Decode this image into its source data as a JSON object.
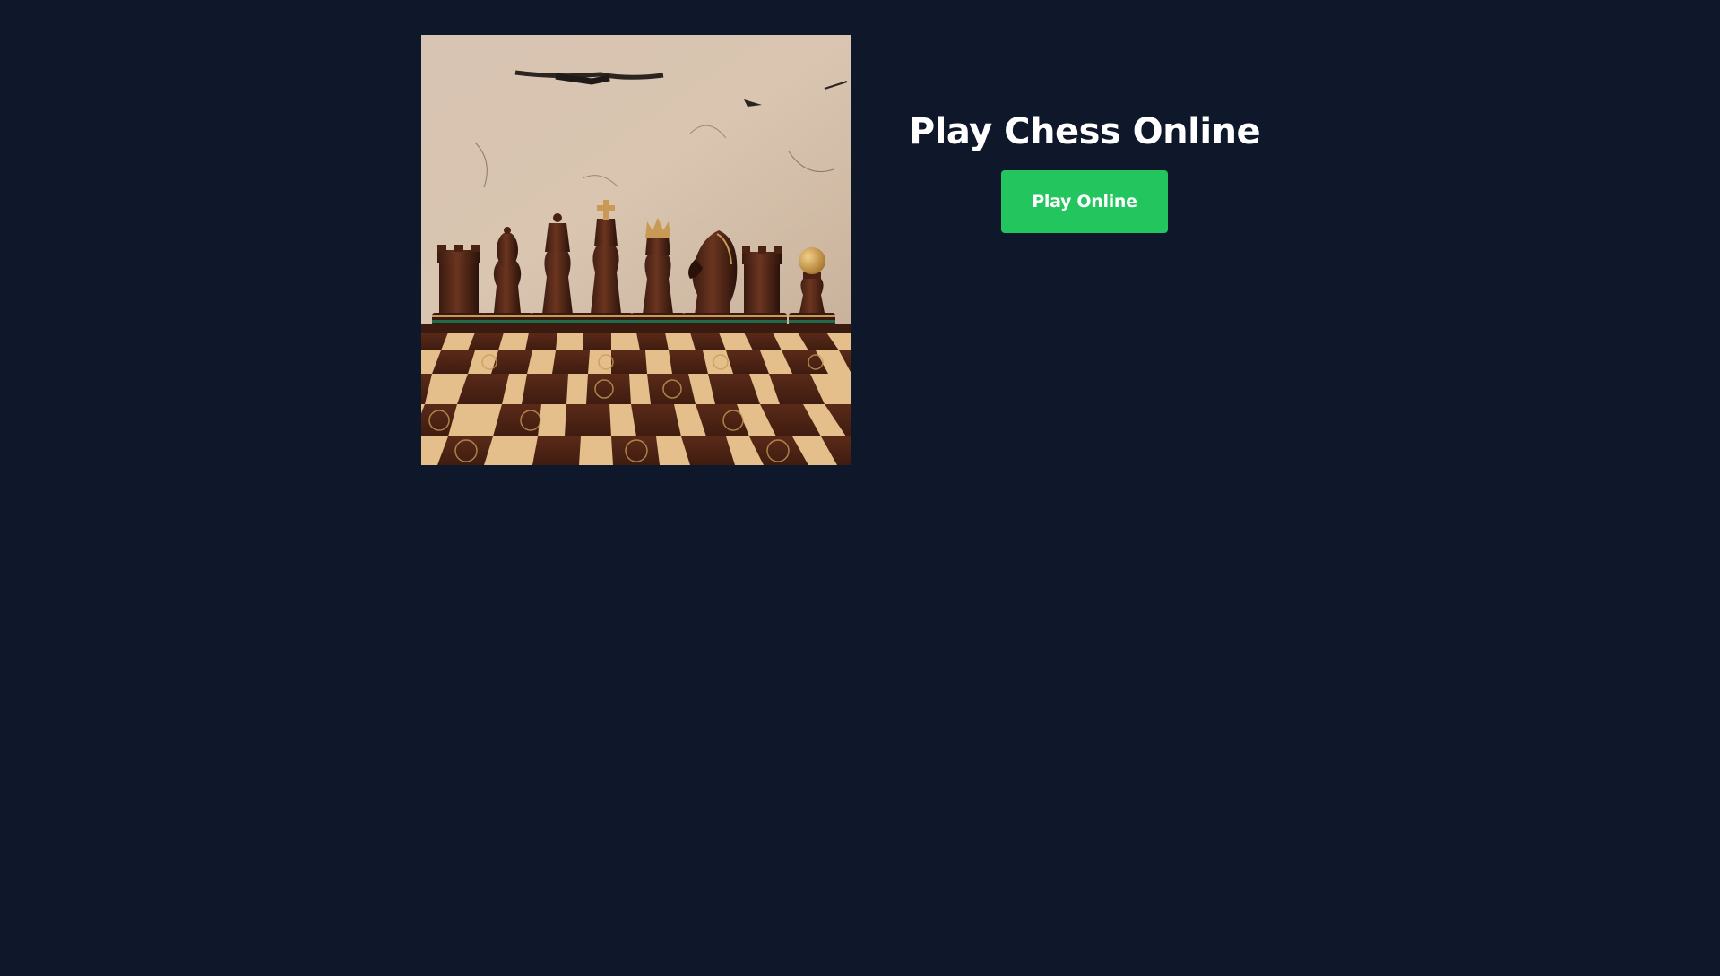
{
  "hero": {
    "title": "Play Chess Online",
    "play_button_label": "Play Online",
    "image_icon": "chess-pieces-photo"
  },
  "colors": {
    "background": "#0f172a",
    "button": "#22c55e",
    "title": "#ffffff"
  }
}
